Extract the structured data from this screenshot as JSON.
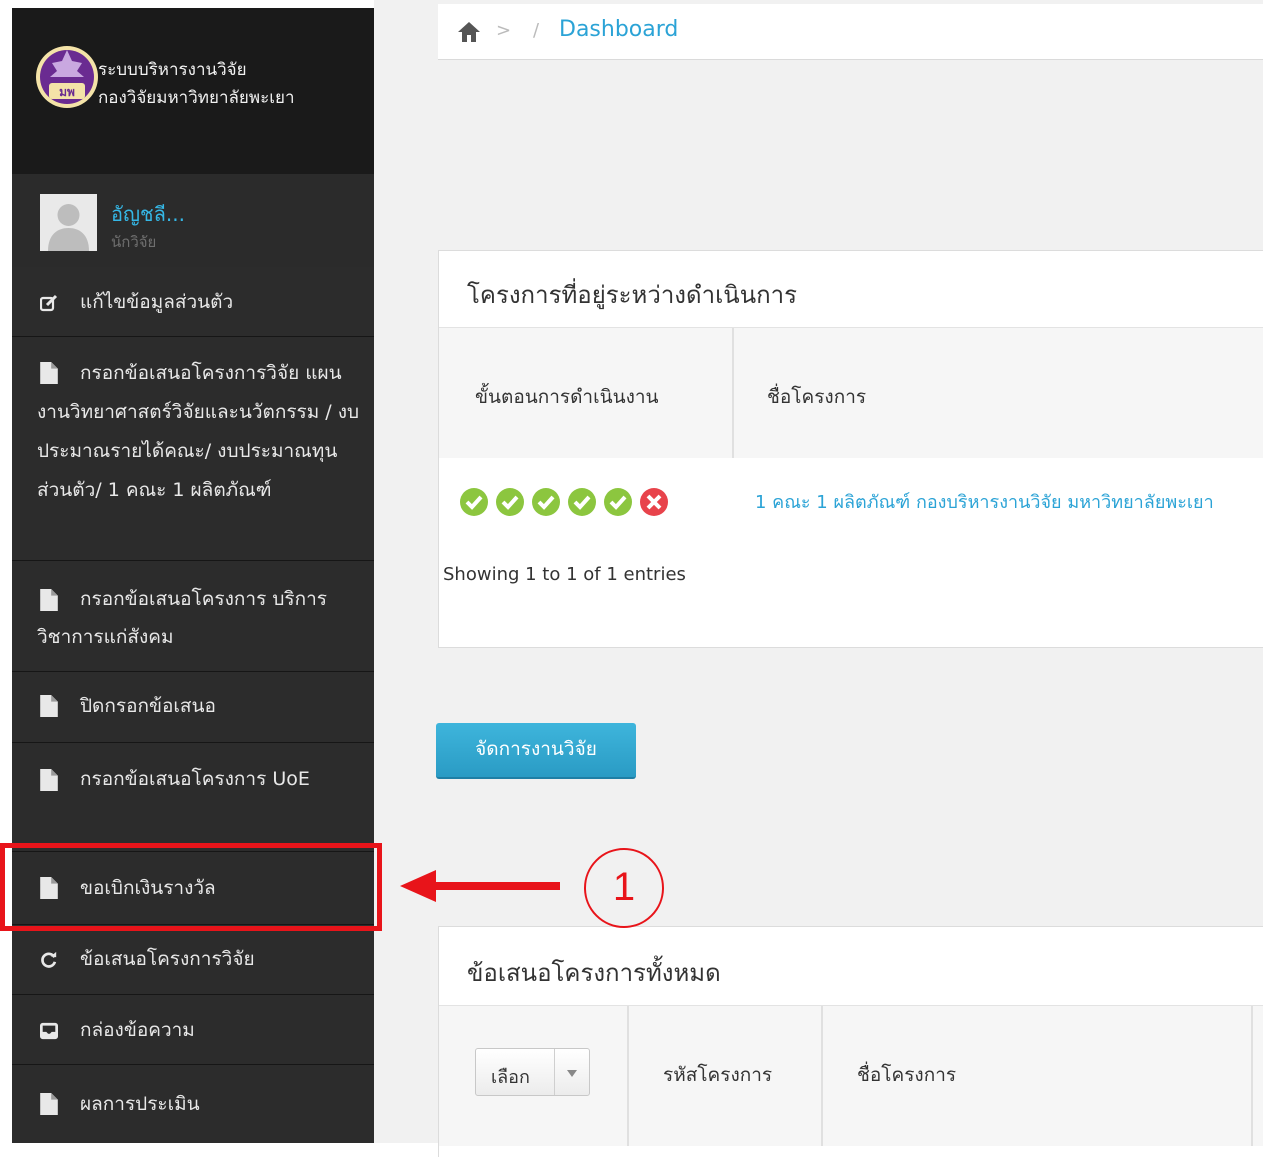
{
  "brand": {
    "line1": "ระบบบริหารงานวิจัย",
    "line2": "กองวิจัยมหาวิทยาลัยพะเยา",
    "logo_text": "มพ"
  },
  "user": {
    "name": "อัญชลี...",
    "role": "นักวิจัย"
  },
  "sidebar": {
    "items": [
      {
        "label": "แก้ไขข้อมูลส่วนตัว",
        "icon": "edit-icon"
      },
      {
        "label": "กรอกข้อเสนอโครงการวิจัย แผนงานวิทยาศาสตร์วิจัยและนวัตกรรม / งบประมาณรายได้คณะ/ งบประมาณทุนส่วนตัว/ 1 คณะ 1 ผลิตภัณฑ์",
        "icon": "file-icon"
      },
      {
        "label": "กรอกข้อเสนอโครงการ บริการวิชาการแก่สังคม",
        "icon": "file-icon"
      },
      {
        "label": "ปิดกรอกข้อเสนอ",
        "icon": "file-icon"
      },
      {
        "label": "กรอกข้อเสนอโครงการ UoE",
        "icon": "file-icon"
      },
      {
        "label": "ขอเบิกเงินรางวัล",
        "icon": "file-icon"
      },
      {
        "label": "ข้อเสนอโครงการวิจัย",
        "icon": "refresh-icon"
      },
      {
        "label": "กล่องข้อความ",
        "icon": "inbox-icon"
      },
      {
        "label": "ผลการประเมิน",
        "icon": "file-icon"
      }
    ]
  },
  "breadcrumb": {
    "separator1": ">",
    "separator2": "/",
    "current": "Dashboard"
  },
  "ongoing": {
    "title": "โครงการที่อยู่ระหว่างดำเนินการ",
    "columns": [
      "ขั้นตอนการดำเนินงาน",
      "ชื่อโครงการ"
    ],
    "row": {
      "steps": [
        "done",
        "done",
        "done",
        "done",
        "done",
        "pending"
      ],
      "project_name": "1 คณะ 1 ผลิตภัณฑ์ กองบริหารงานวิจัย มหาวิทยาลัยพะเยา"
    },
    "info": "Showing 1 to 1 of 1 entries"
  },
  "manage_button": "จัดการงานวิจัย",
  "proposals": {
    "title": "ข้อเสนอโครงการทั้งหมด",
    "select_label": "เลือก",
    "columns": [
      "รหัสโครงการ",
      "ชื่อโครงการ"
    ]
  },
  "annotation": {
    "number": "1"
  },
  "colors": {
    "sidebar": "#2a2a2a",
    "accent": "#2ba3d6",
    "success": "#8cc63f",
    "danger": "#e8434b",
    "annotation": "#e8141a"
  }
}
